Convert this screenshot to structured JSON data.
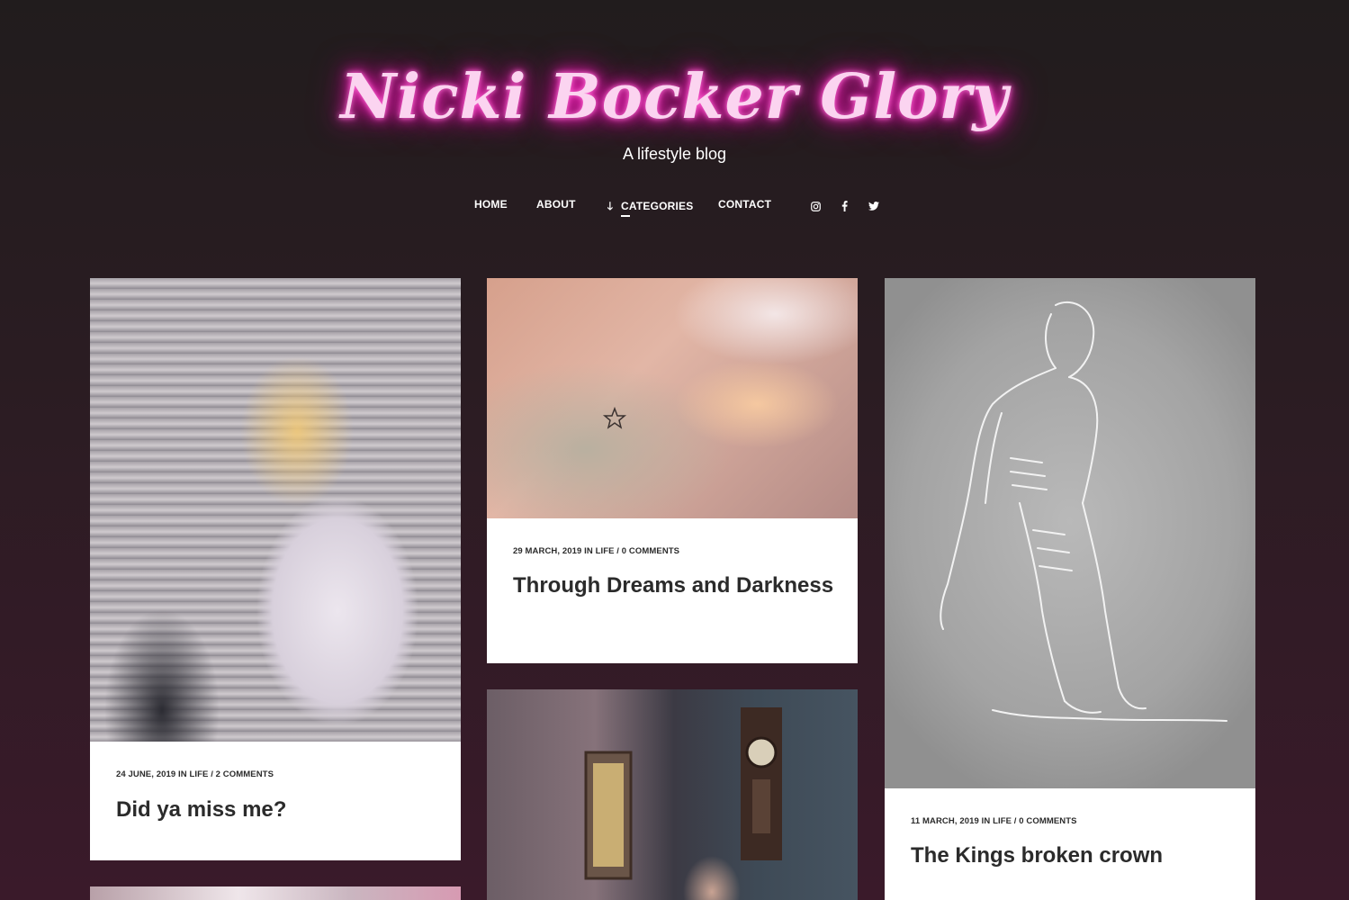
{
  "site": {
    "title": "Nicki Bocker Glory",
    "tagline": "A lifestyle blog"
  },
  "nav": {
    "home": "HOME",
    "about": "ABOUT",
    "categories": "CATEGORIES",
    "contact": "CONTACT"
  },
  "social": {
    "instagram_icon": "instagram-icon",
    "facebook_icon": "facebook-icon",
    "twitter_icon": "twitter-icon"
  },
  "posts": [
    {
      "date": "24 JUNE, 2019",
      "in": "IN",
      "category": "LIFE",
      "comments": "2 COMMENTS",
      "title": "Did ya miss me?"
    },
    {
      "date": "29 MARCH, 2019",
      "in": "IN",
      "category": "LIFE",
      "comments": "0 COMMENTS",
      "title": "Through Dreams and Darkness"
    },
    {
      "date": "11 MARCH, 2019",
      "in": "IN",
      "category": "LIFE",
      "comments": "0 COMMENTS",
      "title": "The Kings broken crown"
    }
  ],
  "colors": {
    "logo_glow": "#ff38c6",
    "background_top": "#211c1d",
    "background_bottom": "#3a1a2a",
    "text_dark": "#2b2b2b"
  }
}
